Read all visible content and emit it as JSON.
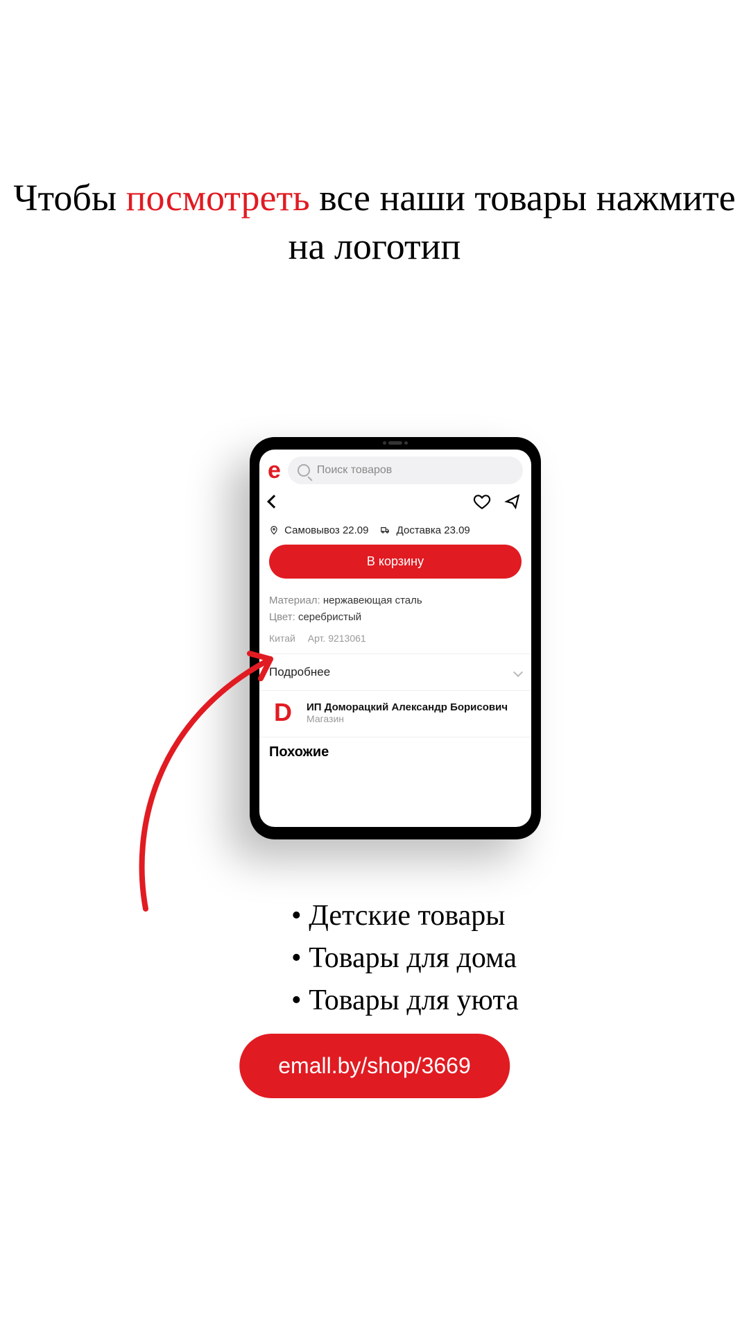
{
  "headline": {
    "pre": "Чтобы ",
    "accent": "посмотреть",
    "post": " все наши товары нажмите на логотип"
  },
  "tablet": {
    "logo": "e",
    "search_placeholder": "Поиск товаров",
    "pickup_label": "Самовывоз 22.09",
    "delivery_label": "Доставка 23.09",
    "cta": "В корзину",
    "spec_material_label": "Материал:",
    "spec_material_value": "нержавеющая сталь",
    "spec_color_label": "Цвет:",
    "spec_color_value": "серебристый",
    "country": "Китай",
    "article": "Арт. 9213061",
    "more": "Подробнее",
    "seller_logo": "D",
    "seller_name": "ИП Доморацкий Александр Борисович",
    "seller_sub": "Магазин",
    "similar": "Похожие"
  },
  "bullets": [
    "Детские товары",
    "Товары для дома",
    "Товары для уюта"
  ],
  "url": "emall.by/shop/3669"
}
